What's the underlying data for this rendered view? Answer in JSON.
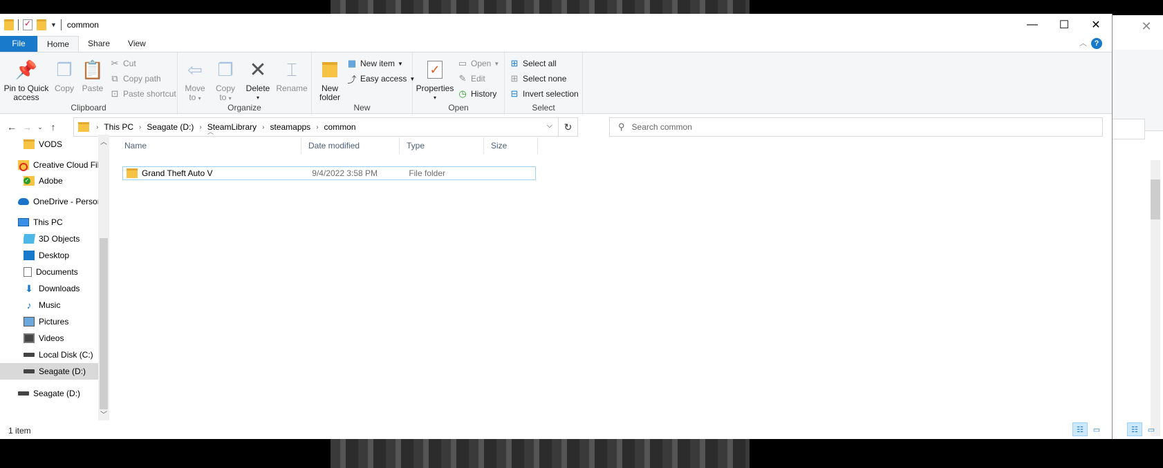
{
  "window": {
    "title": "common",
    "controls": {
      "minimize": "—",
      "maximize": "☐",
      "close": "✕"
    }
  },
  "tabs": [
    "File",
    "Home",
    "Share",
    "View"
  ],
  "help": "?",
  "ribbon": {
    "clipboard": {
      "label": "Clipboard",
      "pin_line1": "Pin to Quick",
      "pin_line2": "access",
      "copy": "Copy",
      "paste": "Paste",
      "cut": "Cut",
      "copy_path": "Copy path",
      "paste_shortcut": "Paste shortcut"
    },
    "organize": {
      "label": "Organize",
      "move_line1": "Move",
      "move_line2": "to",
      "copy_line1": "Copy",
      "copy_line2": "to",
      "delete": "Delete",
      "rename": "Rename"
    },
    "new": {
      "label": "New",
      "new_folder_line1": "New",
      "new_folder_line2": "folder",
      "new_item": "New item",
      "easy_access": "Easy access"
    },
    "open": {
      "label": "Open",
      "properties": "Properties",
      "open": "Open",
      "edit": "Edit",
      "history": "History"
    },
    "select": {
      "label": "Select",
      "select_all": "Select all",
      "select_none": "Select none",
      "invert": "Invert selection"
    }
  },
  "address": {
    "crumbs": [
      "This PC",
      "Seagate (D:)",
      "SteamLibrary",
      "steamapps",
      "common"
    ]
  },
  "search": {
    "placeholder": "Search common"
  },
  "nav": {
    "vods": "VODS",
    "creative_cloud": "Creative Cloud Files",
    "adobe": "Adobe",
    "onedrive": "OneDrive - Personal",
    "this_pc": "This PC",
    "objects3d": "3D Objects",
    "desktop": "Desktop",
    "documents": "Documents",
    "downloads": "Downloads",
    "music": "Music",
    "pictures": "Pictures",
    "videos": "Videos",
    "local_disk": "Local Disk (C:)",
    "seagate_sel": "Seagate (D:)",
    "seagate": "Seagate (D:)"
  },
  "columns": {
    "name": "Name",
    "date": "Date modified",
    "type": "Type",
    "size": "Size"
  },
  "files": [
    {
      "name": "Grand Theft Auto V",
      "date": "9/4/2022 3:58 PM",
      "type": "File folder",
      "size": ""
    }
  ],
  "status": {
    "count": "1 item"
  },
  "colors": {
    "accent": "#1979ca",
    "selection": "#cce8ff",
    "folder": "#f6c344"
  }
}
